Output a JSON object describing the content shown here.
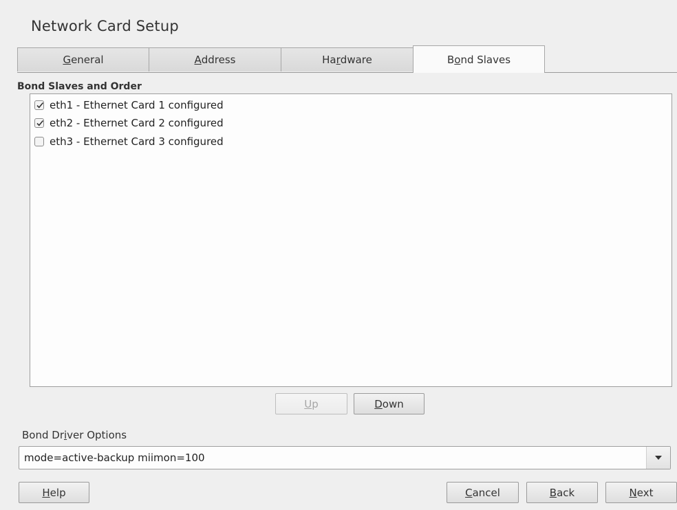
{
  "window": {
    "title": "Network Card Setup"
  },
  "tabs": [
    {
      "label": "General",
      "mnemonic": "G",
      "active": false
    },
    {
      "label": "Address",
      "mnemonic": "A",
      "active": false
    },
    {
      "label": "Hardware",
      "mnemonic": "r",
      "active": false
    },
    {
      "label": "Bond Slaves",
      "mnemonic": "o",
      "active": true
    }
  ],
  "bond_slaves": {
    "label": "Bond Slaves and Order",
    "items": [
      {
        "label": "eth1 - Ethernet Card 1 configured",
        "checked": true
      },
      {
        "label": "eth2 - Ethernet Card 2 configured",
        "checked": true
      },
      {
        "label": "eth3 - Ethernet Card 3 configured",
        "checked": false
      }
    ]
  },
  "order_buttons": {
    "up": {
      "label": "Up",
      "mnemonic": "U",
      "enabled": false
    },
    "down": {
      "label": "Down",
      "mnemonic": "D",
      "enabled": true
    }
  },
  "driver_options": {
    "label": "Bond Driver Options",
    "mnemonic": "i",
    "value": "mode=active-backup miimon=100",
    "arrow_icon": "triangle-down-icon"
  },
  "footer": {
    "help": {
      "label": "Help",
      "mnemonic": "H"
    },
    "cancel": {
      "label": "Cancel",
      "mnemonic": "C"
    },
    "back": {
      "label": "Back",
      "mnemonic": "B"
    },
    "next": {
      "label": "Next",
      "mnemonic": "N"
    }
  },
  "colors": {
    "background": "#efefef",
    "active_tab": "#fafafa",
    "list_background": "#fdfdfd"
  }
}
